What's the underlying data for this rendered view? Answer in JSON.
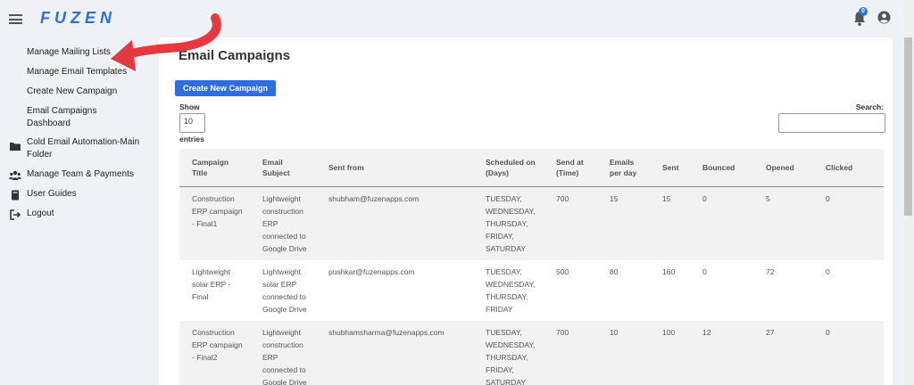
{
  "app": {
    "logo": "FUZEN",
    "notifications_count": "0"
  },
  "sidebar": {
    "items": [
      {
        "label": "Manage Mailing Lists",
        "icon": "none"
      },
      {
        "label": "Manage Email Templates",
        "icon": "none"
      },
      {
        "label": "Create New Campaign",
        "icon": "none"
      },
      {
        "label": "Email Campaigns Dashboard",
        "icon": "none"
      },
      {
        "label": "Cold Email Automation-Main Folder",
        "icon": "folder-icon"
      },
      {
        "label": "Manage Team & Payments",
        "icon": "team-icon"
      },
      {
        "label": "User Guides",
        "icon": "book-icon"
      },
      {
        "label": "Logout",
        "icon": "logout-icon"
      }
    ]
  },
  "main": {
    "title": "Email Campaigns",
    "create_button": "Create New Campaign",
    "show_label": "Show",
    "show_value": "10",
    "entries_label": "entries",
    "search_label": "Search:",
    "search_value": ""
  },
  "table": {
    "headers": [
      "Campaign Title",
      "Email Subject",
      "Sent from",
      "Scheduled on (Days)",
      "Send at (Time)",
      "Emails per day",
      "Sent",
      "Bounced",
      "Opened",
      "Clicked"
    ],
    "rows": [
      [
        "Construction ERP campaign - Final1",
        "Lightweight construction ERP connected to Google Drive",
        "shubham@fuzenapps.com",
        "TUESDAY, WEDNESDAY, THURSDAY, FRIDAY, SATURDAY",
        "700",
        "15",
        "15",
        "0",
        "5",
        "0"
      ],
      [
        "Lightweight solar ERP - Final",
        "Lightweight solar ERP connected to Google Drive",
        "pushkar@fuzenapps.com",
        "TUESDAY, WEDNESDAY, THURSDAY, FRIDAY",
        "500",
        "80",
        "160",
        "0",
        "72",
        "0"
      ],
      [
        "Construction ERP campaign - Final2",
        "Lightweight construction ERP connected to Google Drive",
        "shubhamsharma@fuzenapps.com",
        "TUESDAY, WEDNESDAY, THURSDAY, FRIDAY, SATURDAY",
        "700",
        "10",
        "100",
        "12",
        "27",
        "0"
      ]
    ]
  },
  "colors": {
    "accent": "#2f6ee0",
    "arrow": "#e5393f",
    "background": "#eef1f6"
  }
}
